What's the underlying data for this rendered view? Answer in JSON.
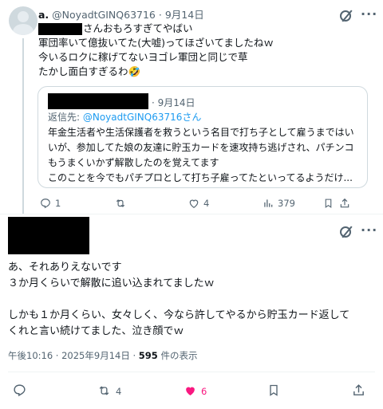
{
  "colors": {
    "like": "#f91880",
    "link": "#1d9bf0",
    "muted": "#536471"
  },
  "top_tweet": {
    "author_name": "a.",
    "handle": "@NoyadtGINQ63716",
    "date": "9月14日",
    "text_line1": "さんおもろすぎてやばい",
    "text_rest": "軍団率いて億抜いてた(大嘘)ってほざいてましたねｗ\n今いるロクに稼げてないヨゴレ軍団と同じで草\nたかし面白すぎるわ🤣",
    "quote": {
      "date": "· 9月14日",
      "reply_prefix": "返信先: ",
      "reply_handle": "@NoyadtGINQ63716さん",
      "text": "年金生活者や生活保護者を救うという名目で打ち子として雇うまではい\nいが、参加してた娘の友達に貯玉カードを速攻持ち逃げされ、パチンコ\nもうまくいかず解散したのを覚えてます\nこのことを今でもパチプロとして打ち子雇ってたといってるようだけ..."
    },
    "actions": {
      "replies": "1",
      "reposts": "",
      "likes": "4",
      "views": "379"
    },
    "icons": [
      "grok-icon",
      "more-icon",
      "reply-icon",
      "repost-icon",
      "like-icon",
      "views-icon",
      "bookmark-icon",
      "share-icon"
    ]
  },
  "main_tweet": {
    "text": "あ、それありえないです\n３か月くらいで解散に追い込まれてましたｗ\n\nしかも１か月くらい、女々しく、今なら許してやるから貯玉カード返して\nくれと言い続けてました、泣き顔でｗ",
    "time": "午後10:16 · 2025年9月14日 · ",
    "views_count": "595",
    "views_suffix": " 件の表示",
    "actions": {
      "reposts": "4",
      "likes": "6"
    }
  }
}
